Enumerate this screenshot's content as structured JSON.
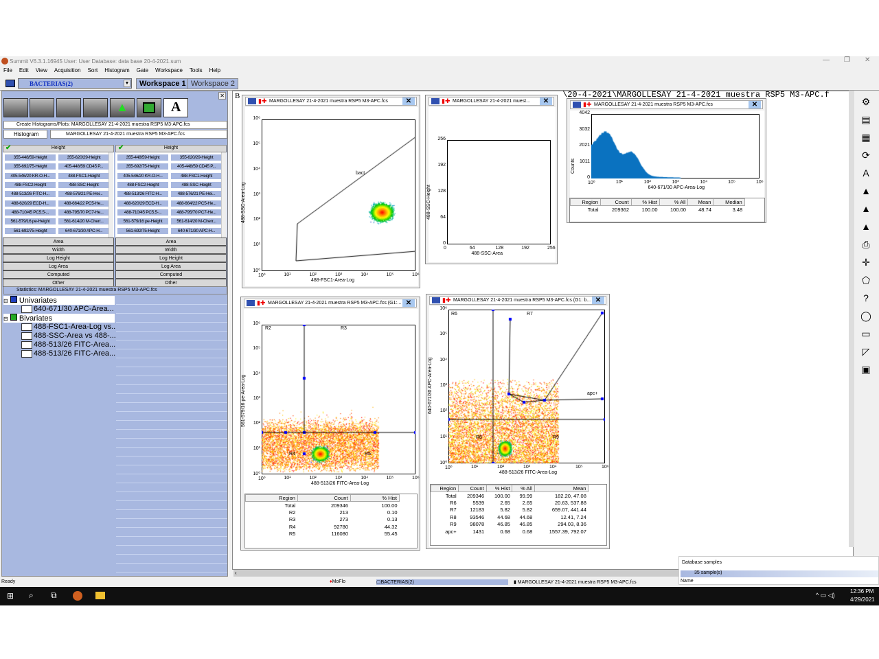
{
  "app": {
    "title": "Summit V6.3.1.16945  User: User  Database: data base 20-4-2021.sum"
  },
  "menu": [
    "File",
    "Edit",
    "View",
    "Acquisition",
    "Sort",
    "Histogram",
    "Gate",
    "Workspace",
    "Tools",
    "Help"
  ],
  "toolbar": {
    "protocol": "BACTERIAS(2)",
    "tabs": [
      "Workspace 1",
      "Workspace 2"
    ]
  },
  "left": {
    "create_header": "Create Histograms/Plots: MARGOLLESAY 21-4-2021 muestra RSP5 M3-APC.fcs",
    "plot_type": "Histogram",
    "sample": "MARGOLLESAY 21-4-2021 muestra RSP5 M3-APC.fcs",
    "param_header": "Height",
    "params": [
      "355-448/59-Height",
      "355-620/29-Height",
      "355-692/75-Height",
      "405-448/59 CD45 P...",
      "405-546/20 KR-O-H...",
      "488-FSC1-Height",
      "488-FSC2-Height",
      "488-SSC-Height",
      "488-513/26 FITC-H...",
      "488-576/21 PE-Hei...",
      "488-620/29 ECD-H...",
      "488-664/22 PC5-He...",
      "488-710/45 PC5.5-...",
      "488-795/70 PC7-He...",
      "561-579/16 pe-Height",
      "561-614/20 M-Cherr...",
      "561-692/75-Height",
      "640-671/30 APC-H..."
    ],
    "categories": [
      "Area",
      "Width",
      "Log Height",
      "Log Area",
      "Computed",
      "Other"
    ],
    "stats_header": "Statistics: MARGOLLESAY 21-4-2021 muestra RSP5 M3-APC.fcs",
    "tree": {
      "univariates": "Univariates",
      "uni_items": [
        "640-671/30 APC-Area..."
      ],
      "bivariates": "Bivariates",
      "bi_items": [
        "488-FSC1-Area-Log vs...",
        "488-SSC-Area vs 488-...",
        "488-513/26 FITC-Area...",
        "488-513/26 FITC-Area..."
      ]
    }
  },
  "workspace": {
    "path_text": "\\20-4-2021\\MARGOLLESAY 21-4-2021 muestra RSP5 M3-APC.f",
    "corner": "B"
  },
  "plots": {
    "p1": {
      "title": "MARGOLLESAY 21-4-2021 muestra RSP5 M3-APC.fcs",
      "xlabel": "488-FSC1-Area-Log",
      "ylabel": "488-SSC-Area-Log",
      "gate": "bact",
      "ticks": [
        "10⁰",
        "10¹",
        "10²",
        "10³",
        "10⁴",
        "10⁵",
        "10⁶"
      ]
    },
    "p2": {
      "title": "MARGOLLESAY 21-4-2021 muest...",
      "xlabel": "488-SSC-Area",
      "ylabel": "488-SSC-Height",
      "ticks": [
        "0",
        "64",
        "128",
        "192",
        "256"
      ]
    },
    "p3": {
      "title": "MARGOLLESAY 21-4-2021 muestra RSP5 M3-APC.fcs",
      "xlabel": "640-671/30 APC-Area-Log",
      "ylabel": "Counts",
      "yticks": [
        "0",
        "1011",
        "2021",
        "3032",
        "4042"
      ],
      "xticks": [
        "10⁰",
        "10¹",
        "10²",
        "10³",
        "10⁴",
        "10⁵",
        "10⁶"
      ],
      "color": "#0a72c0",
      "table": {
        "headers": [
          "Region",
          "Count",
          "% Hist",
          "% All",
          "Mean",
          "Median"
        ],
        "rows": [
          [
            "Total",
            "209362",
            "100.00",
            "100.00",
            "48.74",
            "3.48"
          ]
        ]
      }
    },
    "p4": {
      "title": "MARGOLLESAY 21-4-2021 muestra RSP5 M3-APC.fcs  (G1:...",
      "xlabel": "488-513/26 FITC-Area-Log",
      "ylabel": "561-579/16 pe-Area-Log",
      "regions": [
        "R2",
        "R3",
        "R4",
        "R5"
      ],
      "ticks": [
        "10⁰",
        "10¹",
        "10²",
        "10³",
        "10⁴",
        "10⁵",
        "10⁶"
      ],
      "table": {
        "headers": [
          "Region",
          "Count",
          "% Hist"
        ],
        "rows": [
          [
            "Total",
            "209346",
            "100.00"
          ],
          [
            "R2",
            "213",
            "0.10"
          ],
          [
            "R3",
            "273",
            "0.13"
          ],
          [
            "R4",
            "92780",
            "44.32"
          ],
          [
            "R5",
            "116080",
            "55.45"
          ]
        ]
      }
    },
    "p5": {
      "title": "MARGOLLESAY 21-4-2021 muestra RSP5 M3-APC.fcs  (G1: b...",
      "xlabel": "488-513/26 FITC-Area-Log",
      "ylabel": "640-671/30 APC-Area-Log",
      "regions": [
        "R6",
        "R7",
        "R8",
        "R9",
        "apc+"
      ],
      "ticks": [
        "10⁰",
        "10¹",
        "10²",
        "10³",
        "10⁴",
        "10⁵",
        "10⁶"
      ],
      "table": {
        "headers": [
          "Region",
          "Count",
          "% Hist",
          "% All",
          "Mean"
        ],
        "rows": [
          [
            "Total",
            "209346",
            "100.00",
            "99.99",
            "182.20, 47.08"
          ],
          [
            "R6",
            "5539",
            "2.65",
            "2.65",
            "20.63, 537.88"
          ],
          [
            "R7",
            "12183",
            "5.82",
            "5.82",
            "659.07, 441.44"
          ],
          [
            "R8",
            "93546",
            "44.68",
            "44.68",
            "12.41,  7.24"
          ],
          [
            "R9",
            "98078",
            "46.85",
            "46.85",
            "294.03,  8.36"
          ],
          [
            "apc+",
            "1431",
            "0.68",
            "0.68",
            "1557.39, 792.07"
          ]
        ]
      }
    }
  },
  "db": {
    "title": "Database samples",
    "count": "35 sample(s)",
    "col": "Name"
  },
  "status": {
    "text": "Ready",
    "items": [
      "MoFlo",
      "BACTERIAS(2)",
      "MARGOLLESAY 21-4-2021 muestra RSP5 M3-APC.fcs"
    ]
  },
  "taskbar": {
    "time": "12:36 PM",
    "date": "4/29/2021"
  }
}
